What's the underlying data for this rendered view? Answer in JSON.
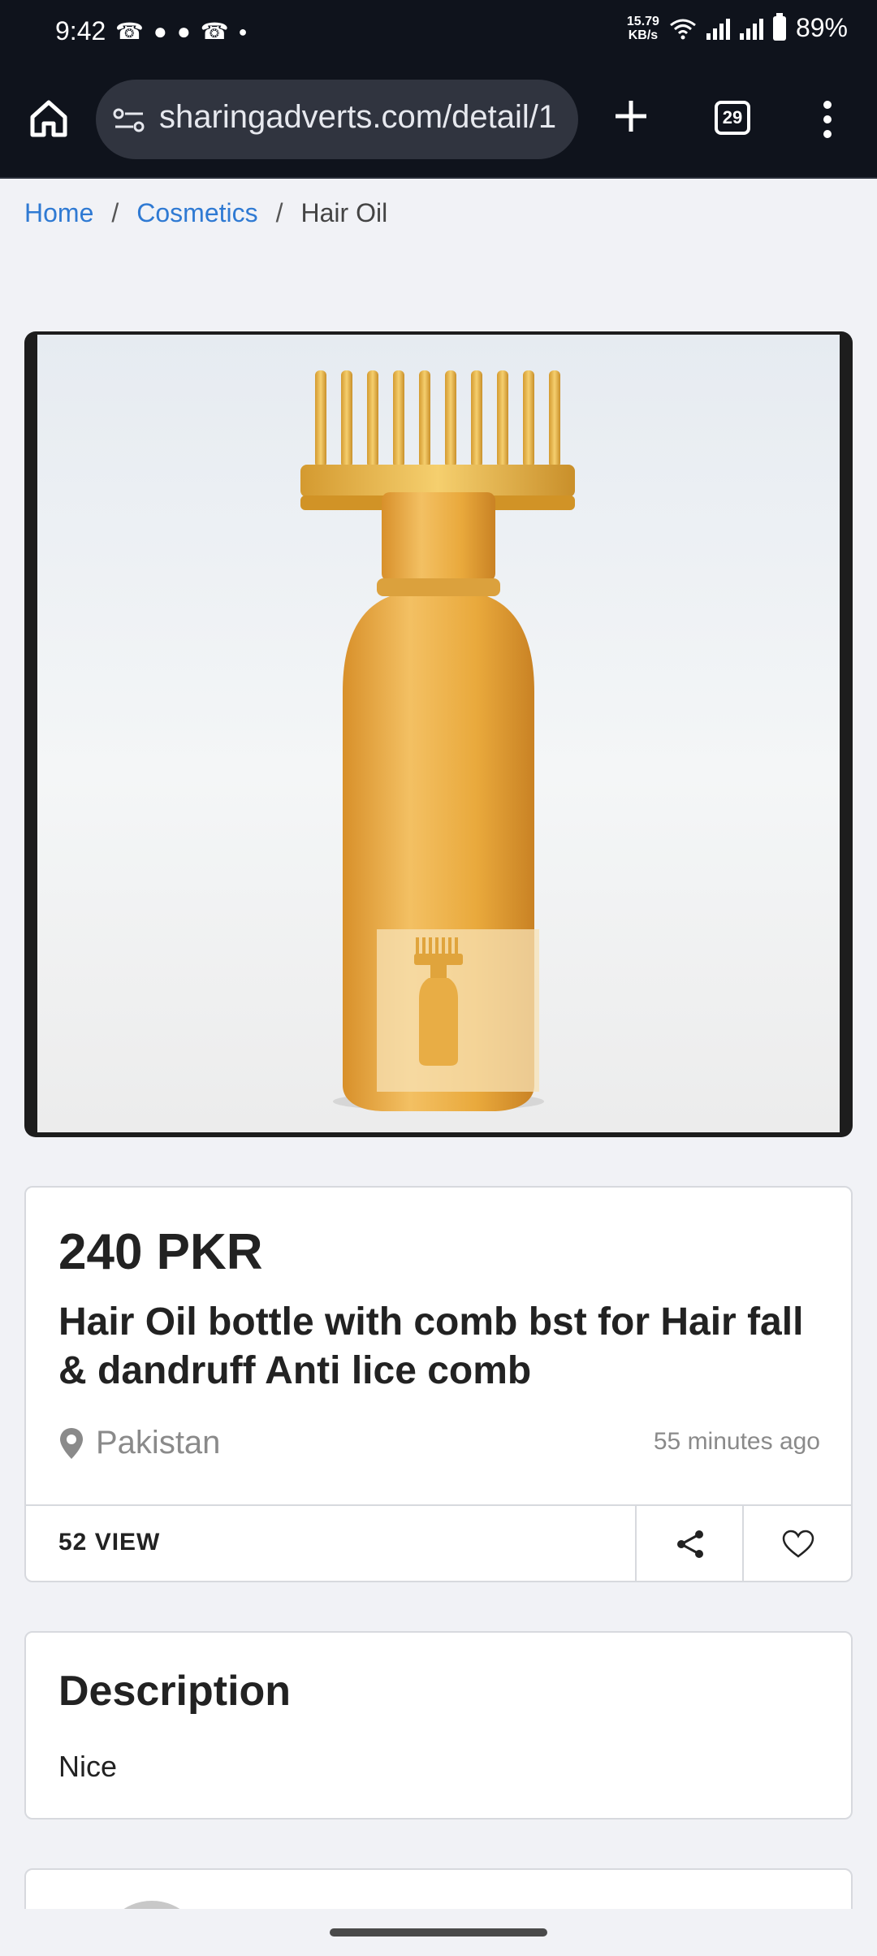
{
  "status_bar": {
    "time": "9:42",
    "notification_icons": [
      "whatsapp-icon",
      "snapchat-icon",
      "snapchat-icon",
      "whatsapp-business-icon",
      "dot-icon"
    ],
    "net_speed_value": "15.79",
    "net_speed_unit": "KB/s",
    "battery": "89%"
  },
  "browser": {
    "url": "sharingadverts.com/detail/1",
    "tab_count": "29"
  },
  "breadcrumb": {
    "home": "Home",
    "category": "Cosmetics",
    "current": "Hair Oil",
    "separator": "/"
  },
  "listing": {
    "price": "240 PKR",
    "title": "Hair Oil bottle with comb bst for Hair fall & dandruff Anti lice comb",
    "location": "Pakistan",
    "posted": "55 minutes ago",
    "views": "52 VIEW"
  },
  "description": {
    "heading": "Description",
    "text": "Nice"
  },
  "colors": {
    "link": "#2f7ad3",
    "bottle_gold": "#e9a93c",
    "chrome_bg": "#0f131c"
  }
}
